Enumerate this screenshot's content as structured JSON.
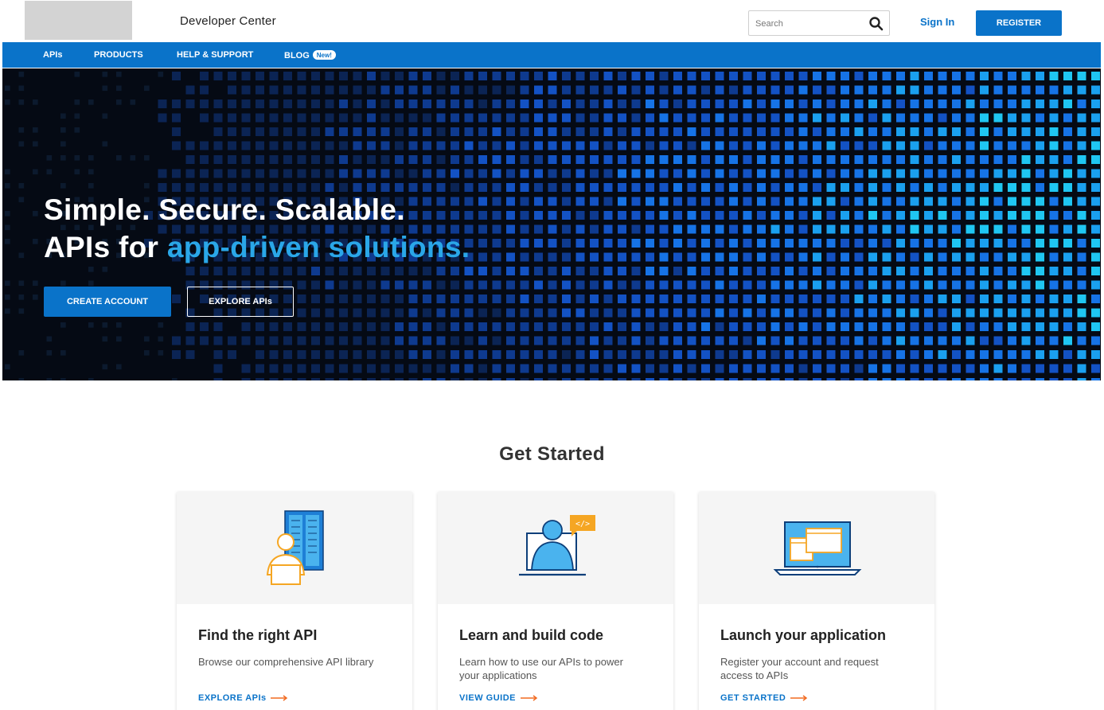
{
  "header": {
    "site_title": "Developer Center",
    "search_placeholder": "Search",
    "sign_in": "Sign In",
    "register": "REGISTER"
  },
  "nav": {
    "items": [
      {
        "label": "APIs"
      },
      {
        "label": "PRODUCTS"
      },
      {
        "label": "HELP & SUPPORT"
      },
      {
        "label": "BLOG",
        "badge": "New!"
      }
    ]
  },
  "hero": {
    "line1": "Simple. Secure. Scalable.",
    "line2_prefix": "APIs for ",
    "line2_accent": "app-driven solutions.",
    "primary_button": "CREATE ACCOUNT",
    "secondary_button": "EXPLORE APIs"
  },
  "get_started": {
    "title": "Get Started",
    "cards": [
      {
        "title": "Find the right API",
        "description": "Browse our comprehensive API library",
        "link": "EXPLORE APIs",
        "icon": "server-person-icon"
      },
      {
        "title": "Learn and build code",
        "description": "Learn how to use our APIs to power your applications",
        "link": "VIEW GUIDE",
        "icon": "developer-laptop-icon"
      },
      {
        "title": "Launch your application",
        "description": "Register your account and request access to APIs",
        "link": "GET STARTED",
        "icon": "laptop-windows-icon"
      }
    ]
  },
  "colors": {
    "brand_blue": "#0a73c9",
    "accent_cyan": "#2aa7e8",
    "icon_orange": "#f5a623",
    "hero_bg": "#050a14"
  }
}
